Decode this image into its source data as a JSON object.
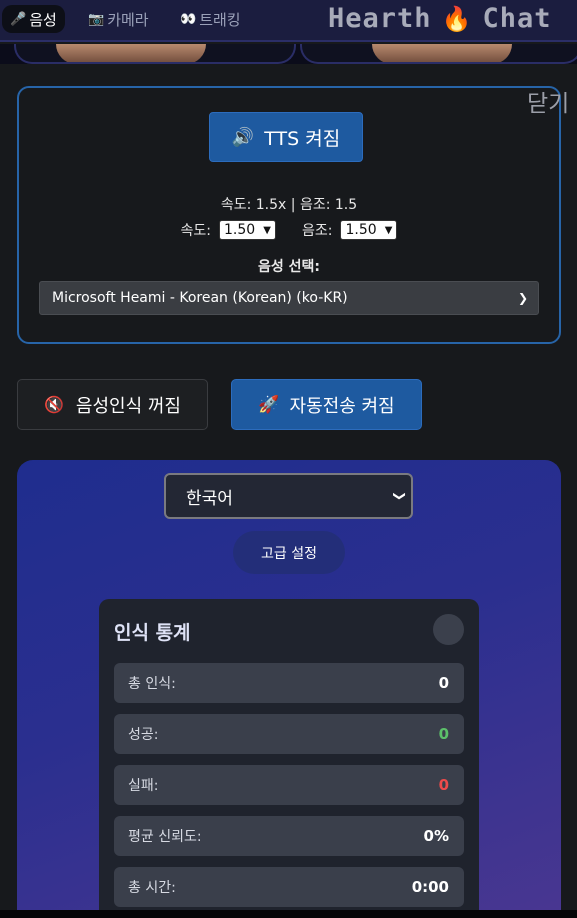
{
  "nav": {
    "tabs": [
      {
        "label": "음성",
        "icon": "microphone-icon",
        "glyph": "🎤",
        "active": true
      },
      {
        "label": "카메라",
        "icon": "camera-icon",
        "glyph": "📷",
        "active": false
      },
      {
        "label": "트래킹",
        "icon": "tracking-icon",
        "glyph": "👀",
        "active": false
      }
    ],
    "brand_left": "Hearth",
    "brand_right": "Chat",
    "brand_icon": "🔥"
  },
  "tts": {
    "close_label": "닫기",
    "toggle_label": "TTS 켜짐",
    "toggle_icon": "🔊",
    "summary": "속도: 1.5x | 음조: 1.5",
    "rate_label": "속도:",
    "rate_value": "1.50",
    "pitch_label": "음조:",
    "pitch_value": "1.50",
    "voice_label": "음성 선택:",
    "voice_value": "Microsoft Heami - Korean (Korean) (ko-KR)"
  },
  "actions": {
    "speech_label": "음성인식 꺼짐",
    "speech_icon": "🔇",
    "auto_label": "자동전송 켜짐",
    "auto_icon": "🚀"
  },
  "recognition": {
    "language_value": "한국어",
    "advanced_label": "고급 설정",
    "stats_title": "인식 통계",
    "stats": [
      {
        "label": "총 인식:",
        "value": "0",
        "tone": "normal"
      },
      {
        "label": "성공:",
        "value": "0",
        "tone": "green"
      },
      {
        "label": "실패:",
        "value": "0",
        "tone": "red"
      },
      {
        "label": "평균 신뢰도:",
        "value": "0%",
        "tone": "normal"
      },
      {
        "label": "총 시간:",
        "value": "0:00",
        "tone": "normal"
      }
    ]
  },
  "colors": {
    "accent_blue": "#1e5aa0",
    "panel_border": "#2764a8",
    "success": "#5cc06a",
    "failure": "#ee4b4b",
    "brand_flame": "#ff7a2a"
  }
}
